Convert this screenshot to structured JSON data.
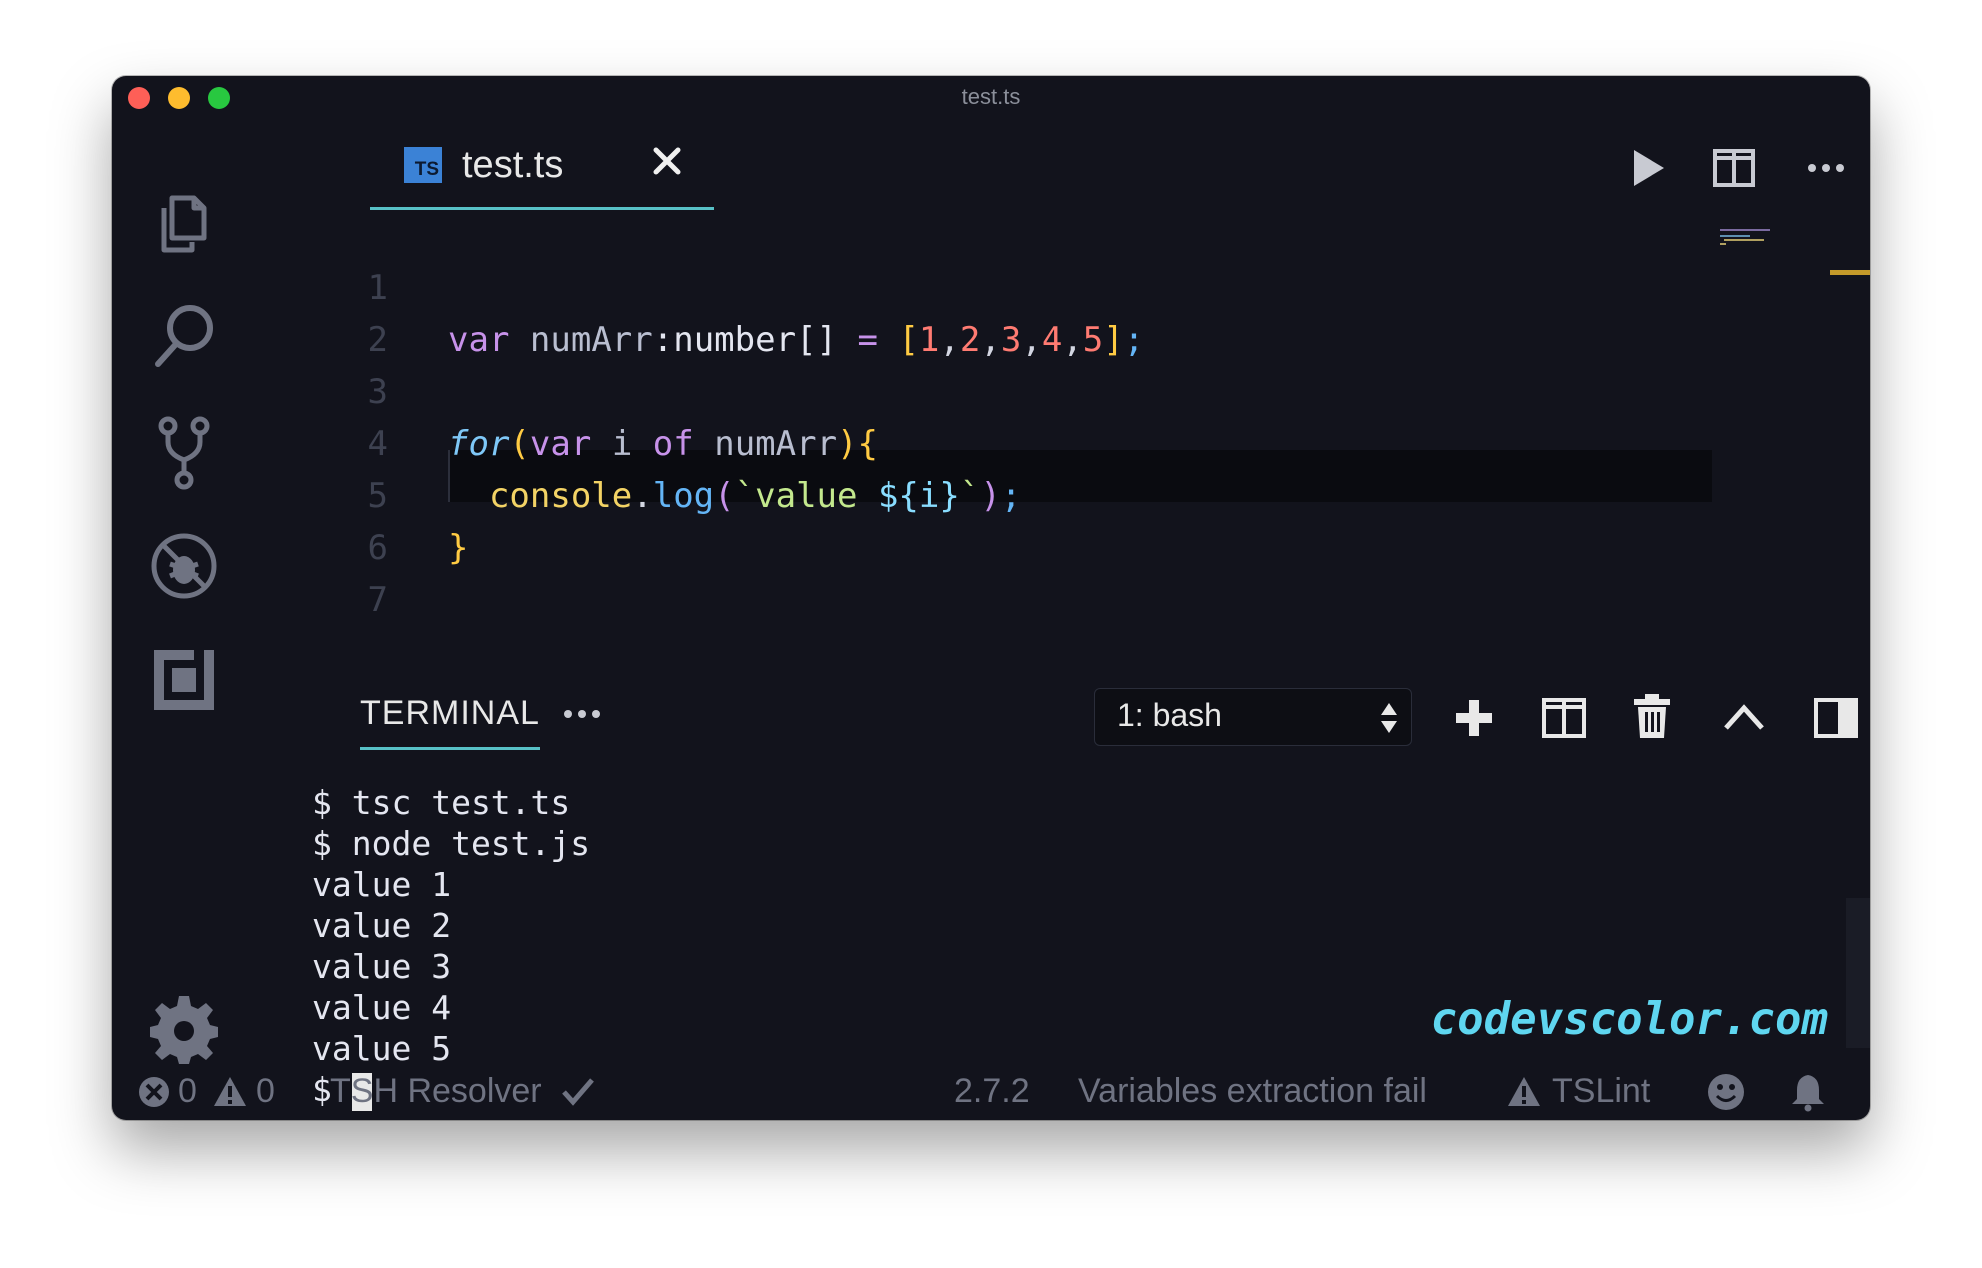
{
  "window": {
    "title": "test.ts"
  },
  "tabs": [
    {
      "label": "test.ts",
      "badge": "TS"
    }
  ],
  "editor": {
    "lines": [
      {
        "n": "1"
      },
      {
        "n": "2"
      },
      {
        "n": "3"
      },
      {
        "n": "4"
      },
      {
        "n": "5"
      },
      {
        "n": "6"
      },
      {
        "n": "7"
      }
    ],
    "code": {
      "l1_var": "var",
      "l1_name": "numArr",
      "l1_colon": ":",
      "l1_type": "number[]",
      "l1_eq": "=",
      "l1_open": "[",
      "l1_n1": "1",
      "l1_n2": "2",
      "l1_n3": "3",
      "l1_n4": "4",
      "l1_n5": "5",
      "l1_comma": ",",
      "l1_close": "]",
      "l1_semi": ";",
      "l3_for": "for",
      "l3_paren_open": "(",
      "l3_var": "var",
      "l3_i": "i",
      "l3_of": "of",
      "l3_arr": "numArr",
      "l3_paren_close": ")",
      "l3_brace": "{",
      "l4_console": "console",
      "l4_dot": ".",
      "l4_log": "log",
      "l4_po": "(",
      "l4_tick": "`",
      "l4_str": "value ",
      "l4_tpl": "${i}",
      "l4_pc": ")",
      "l4_semi": ";",
      "l5_brace": "}"
    }
  },
  "panel": {
    "tab_label": "TERMINAL",
    "more_label": "•••",
    "shell_select": "1: bash"
  },
  "terminal": {
    "lines": [
      "$ tsc test.ts",
      "$ node test.js",
      "value 1",
      "value 2",
      "value 3",
      "value 4",
      "value 5",
      "$ "
    ]
  },
  "watermark": "codevscolor.com",
  "statusbar": {
    "errors": "0",
    "warnings": "0",
    "resolver": "TSH Resolver",
    "version": "2.7.2",
    "message": "Variables extraction fail",
    "lint": "TSLint"
  },
  "colors": {
    "background": "#12131c",
    "accent": "#58c1c7",
    "keyword": "#c792ea",
    "number": "#ff7b72",
    "string": "#c3e88d"
  },
  "icons": [
    "explorer-icon",
    "search-icon",
    "source-control-icon",
    "debug-icon",
    "extensions-icon",
    "gear-icon",
    "play-icon",
    "split-editor-icon",
    "more-icon",
    "plus-icon",
    "trash-icon",
    "chevron-up-icon",
    "panel-layout-icon",
    "close-icon",
    "error-icon",
    "warning-icon",
    "check-icon",
    "smiley-icon",
    "bell-icon"
  ]
}
